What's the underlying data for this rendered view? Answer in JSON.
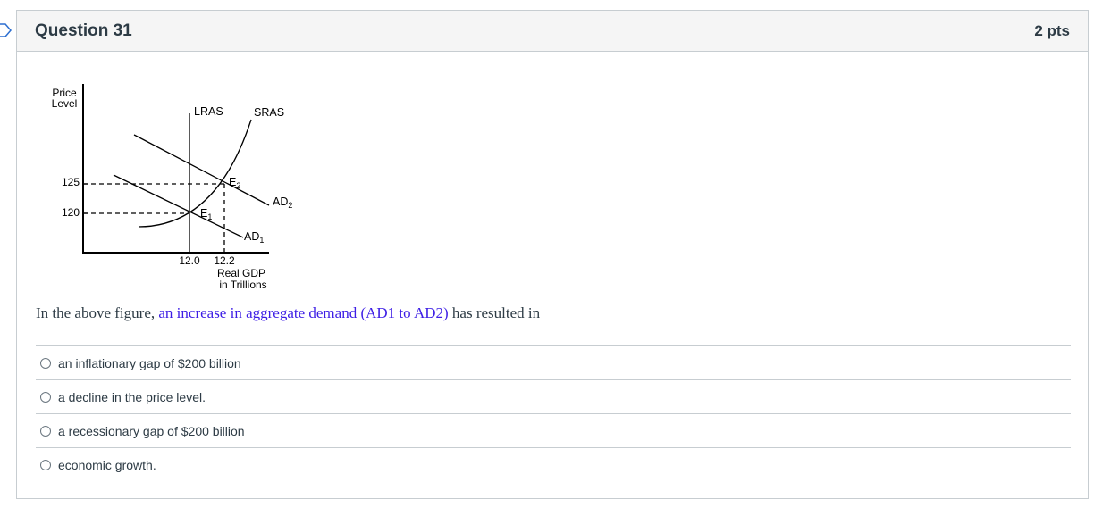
{
  "question": {
    "title": "Question 31",
    "points": "2 pts"
  },
  "figure": {
    "y_axis_label_line1": "Price",
    "y_axis_label_line2": "Level",
    "price_high": "125",
    "price_low": "120",
    "lras_label": "LRAS",
    "sras_label": "SRAS",
    "ad1_label": "AD",
    "ad1_sub": "1",
    "ad2_label": "AD",
    "ad2_sub": "2",
    "e1_label": "E",
    "e1_sub": "1",
    "e2_label": "E",
    "e2_sub": "2",
    "gdp_low": "12.0",
    "gdp_high": "12.2",
    "x_axis_label_line1": "Real GDP",
    "x_axis_label_line2": "in Trillions"
  },
  "prompt": {
    "before": "In the above figure, ",
    "highlight": "an increase in aggregate demand (AD1 to AD2)",
    "after": " has resulted in"
  },
  "answers": [
    {
      "label": "an inflationary gap of $200 billion"
    },
    {
      "label": "a decline in the price level."
    },
    {
      "label": "a recessionary gap of $200 billion"
    },
    {
      "label": "economic growth."
    }
  ]
}
